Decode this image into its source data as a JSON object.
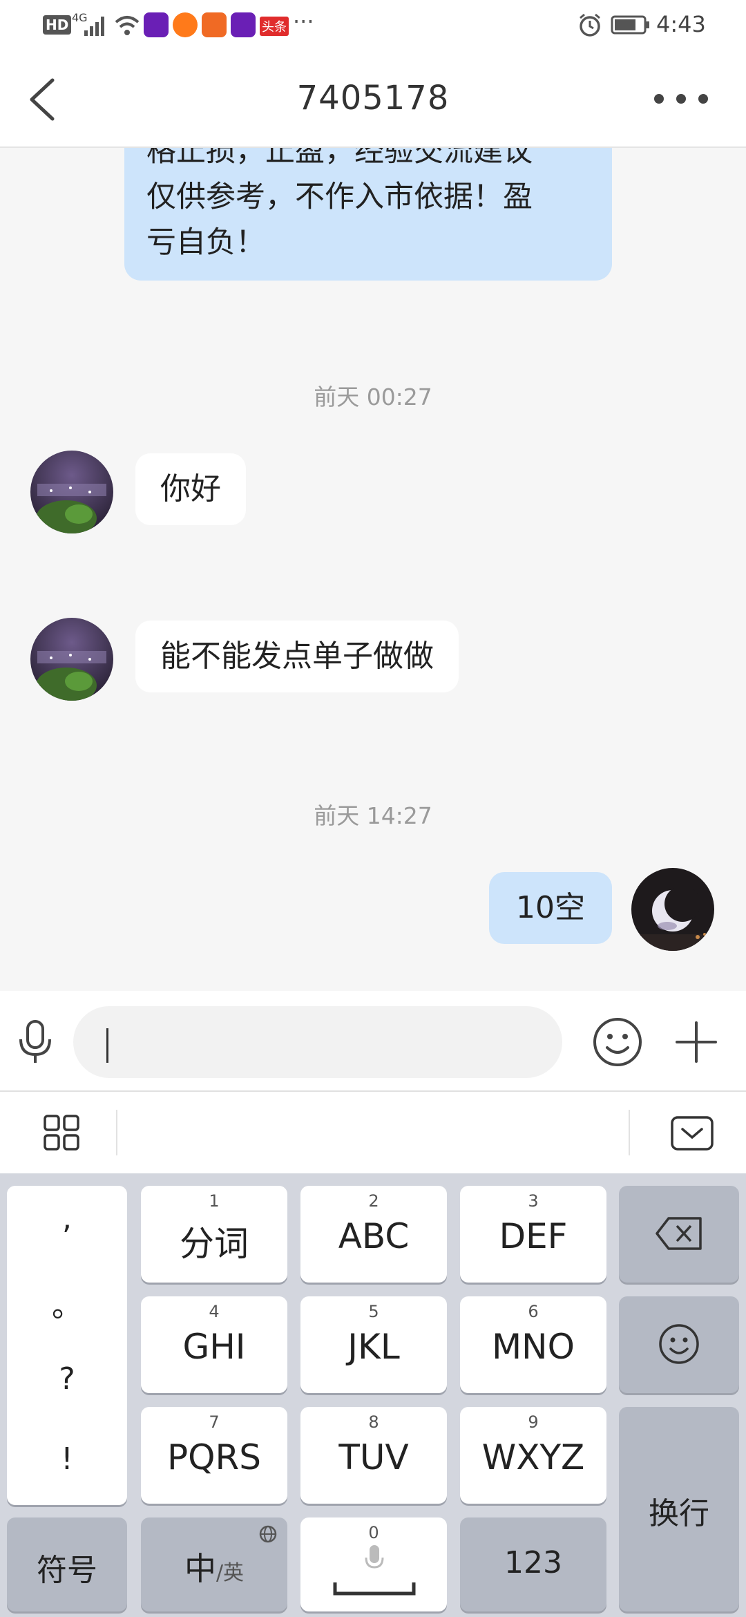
{
  "status_bar": {
    "hd": "HD",
    "net": "4G",
    "toutiao_badge": "头条",
    "more": "···",
    "time": "4:43"
  },
  "header": {
    "title": "7405178"
  },
  "chat": {
    "partial_message": {
      "lines": [
        "格止损，止盈，经验交流建议",
        "仅供参考，不作入市依据！盈",
        "亏自负！"
      ]
    },
    "timestamp_1": "前天 00:27",
    "msg_hello": "你好",
    "msg_request": "能不能发点单子做做",
    "timestamp_2": "前天 14:27",
    "msg_reply": "10空"
  },
  "input": {
    "placeholder": ""
  },
  "keyboard": {
    "punct": [
      ",",
      "。",
      "?",
      "!"
    ],
    "keys": [
      {
        "num": "1",
        "label": "分词"
      },
      {
        "num": "2",
        "label": "ABC"
      },
      {
        "num": "3",
        "label": "DEF"
      },
      {
        "num": "4",
        "label": "GHI"
      },
      {
        "num": "5",
        "label": "JKL"
      },
      {
        "num": "6",
        "label": "MNO"
      },
      {
        "num": "7",
        "label": "PQRS"
      },
      {
        "num": "8",
        "label": "TUV"
      },
      {
        "num": "9",
        "label": "WXYZ"
      }
    ],
    "symbols": "符号",
    "lang_main": "中",
    "lang_alt": "/英",
    "space_num": "0",
    "num_key": "123",
    "enter": "换行"
  },
  "colors": {
    "outgoing_bubble": "#cde4fb",
    "incoming_bubble": "#ffffff",
    "keyboard_bg": "#d3d6de"
  }
}
